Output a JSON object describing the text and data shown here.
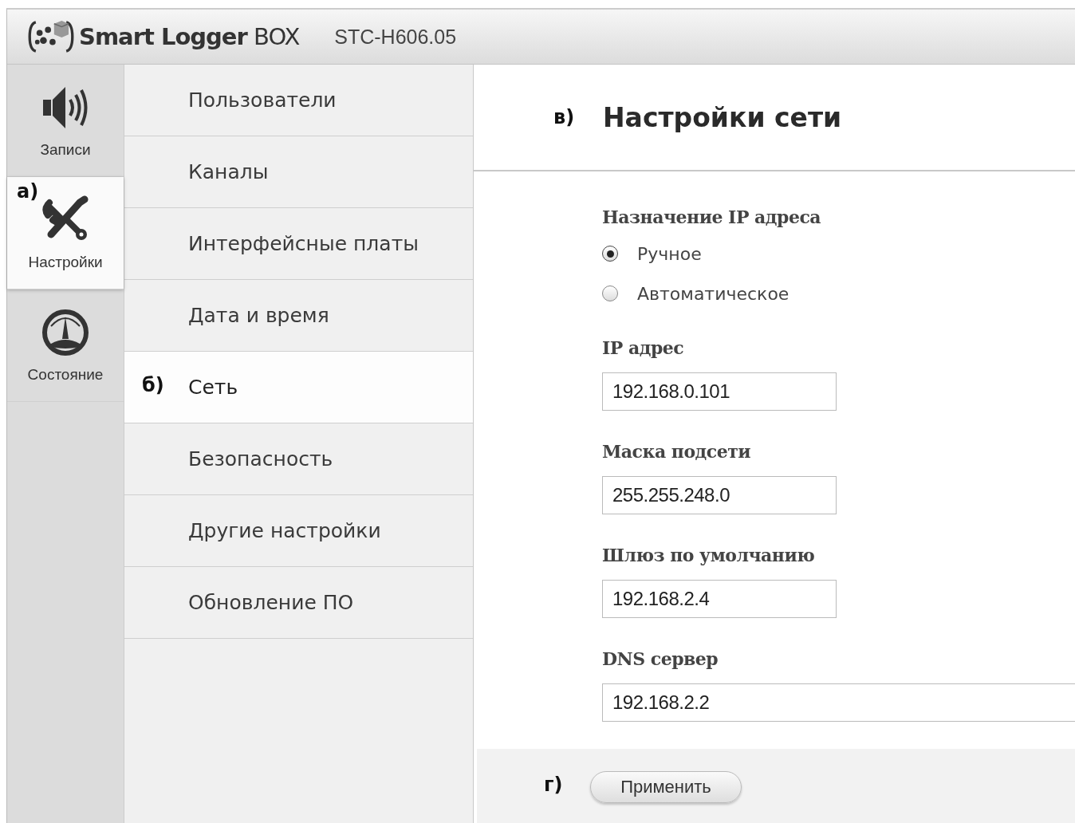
{
  "header": {
    "brand": "**Smart Logger** BOX",
    "model": "STC-H606.05"
  },
  "sidebar": {
    "items": [
      {
        "kind": "speaker",
        "label": "Записи",
        "selected": false
      },
      {
        "kind": "tools",
        "label": "Настройки",
        "selected": true,
        "marker": "а)"
      },
      {
        "kind": "gauge",
        "label": "Состояние",
        "selected": false
      }
    ]
  },
  "submenu": {
    "items": [
      {
        "label": "Пользователи",
        "selected": false
      },
      {
        "label": "Каналы",
        "selected": false
      },
      {
        "label": "Интерфейсные платы",
        "selected": false
      },
      {
        "label": "Дата и время",
        "selected": false
      },
      {
        "label": "Сеть",
        "selected": true,
        "marker": "б)"
      },
      {
        "label": "Безопасность",
        "selected": false
      },
      {
        "label": "Другие настройки",
        "selected": false
      },
      {
        "label": "Обновление ПО",
        "selected": false
      }
    ]
  },
  "content": {
    "marker": "в)",
    "title": "Настройки сети",
    "assignment": {
      "label": "Назначение IP адреса",
      "options": [
        {
          "label": "Ручное",
          "selected": true
        },
        {
          "label": "Автоматическое",
          "selected": false
        }
      ]
    },
    "fields": [
      {
        "label": "IP адрес",
        "value": "192.168.0.101"
      },
      {
        "label": "Маска подсети",
        "value": "255.255.248.0"
      },
      {
        "label": "Шлюз по умолчанию",
        "value": "192.168.2.4"
      },
      {
        "label": "DNS сервер",
        "value": "192.168.2.2"
      }
    ],
    "footer": {
      "marker": "г)",
      "apply_button": "Применить"
    }
  }
}
